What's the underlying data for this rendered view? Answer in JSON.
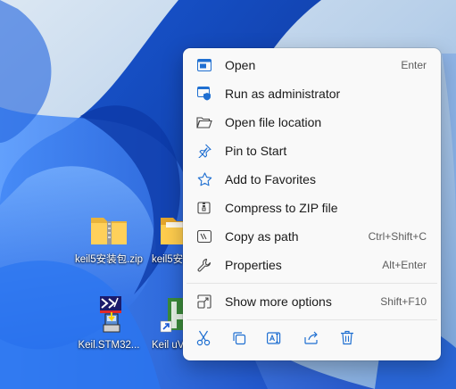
{
  "desktop": {
    "icons": [
      {
        "label": "keil5安装包.zip",
        "icon": "zip-folder-icon"
      },
      {
        "label": "keil5安装",
        "icon": "folder-icon"
      },
      {
        "label": "Keil.STM32...",
        "icon": "keil-stm32-pack-icon"
      },
      {
        "label": "Keil uVis",
        "icon": "keil-uvision-icon"
      }
    ]
  },
  "context_menu": {
    "items": [
      {
        "label": "Open",
        "shortcut": "Enter",
        "icon": "open-app-icon"
      },
      {
        "label": "Run as administrator",
        "shortcut": "",
        "icon": "shield-admin-icon"
      },
      {
        "label": "Open file location",
        "shortcut": "",
        "icon": "folder-open-icon"
      },
      {
        "label": "Pin to Start",
        "shortcut": "",
        "icon": "pin-icon"
      },
      {
        "label": "Add to Favorites",
        "shortcut": "",
        "icon": "star-icon"
      },
      {
        "label": "Compress to ZIP file",
        "shortcut": "",
        "icon": "zip-compress-icon"
      },
      {
        "label": "Copy as path",
        "shortcut": "Ctrl+Shift+C",
        "icon": "copy-path-icon"
      },
      {
        "label": "Properties",
        "shortcut": "Alt+Enter",
        "icon": "wrench-icon"
      },
      {
        "label": "Show more options",
        "shortcut": "Shift+F10",
        "icon": "more-options-icon"
      }
    ],
    "quick_actions": [
      {
        "name": "cut",
        "icon": "scissors-icon"
      },
      {
        "name": "copy",
        "icon": "copy-icon"
      },
      {
        "name": "rename",
        "icon": "rename-icon"
      },
      {
        "name": "share",
        "icon": "share-icon"
      },
      {
        "name": "delete",
        "icon": "trash-icon"
      }
    ],
    "accent_color": "#1f6fd1"
  }
}
